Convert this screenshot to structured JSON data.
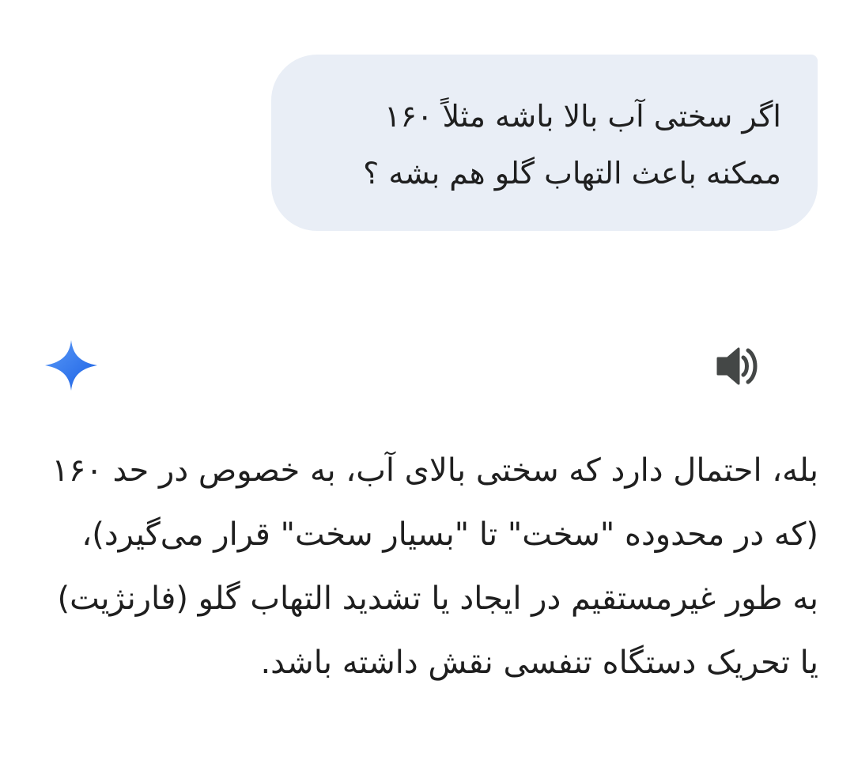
{
  "user_message": {
    "text": "اگر سختی آب بالا باشه مثلاً ۱۶۰\nممکنه باعث التهاب گلو هم بشه ؟"
  },
  "response": {
    "text": "بله، احتمال دارد که سختی بالای آب، به خصوص در حد ۱۶۰ (که در محدوده \"سخت\" تا \"بسیار سخت\" قرار می‌گیرد)، به طور غیرمستقیم در ایجاد یا تشدید التهاب گلو (فارنژیت) یا تحریک دستگاه تنفسی نقش داشته باشد."
  },
  "icons": {
    "assistant": "gemini-sparkle-icon",
    "read_aloud": "speaker-icon"
  },
  "colors": {
    "bubble_bg": "#e9eef6",
    "text": "#1f1f1f",
    "sparkle_top": "#4f8df5",
    "sparkle_bottom": "#1a62e6",
    "speaker": "#444746"
  }
}
